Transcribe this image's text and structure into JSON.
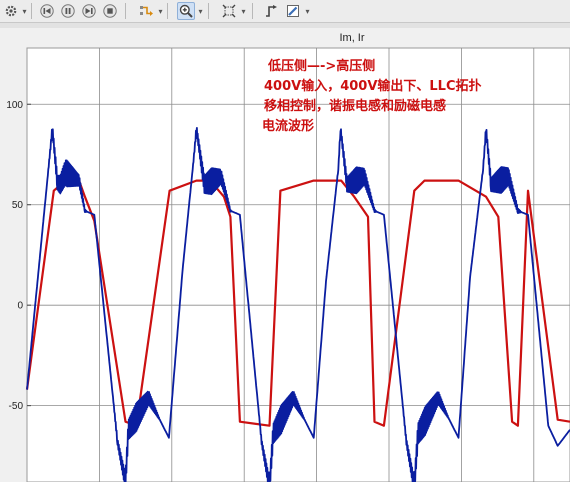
{
  "toolbar": {
    "items": [
      {
        "icon": "gear-icon",
        "dropdown": true
      },
      {
        "icon": "step-back-icon"
      },
      {
        "icon": "pause-icon"
      },
      {
        "icon": "step-forward-icon"
      },
      {
        "icon": "stop-icon"
      },
      {
        "icon": "highlight-signal-icon",
        "dropdown": true
      },
      {
        "icon": "zoom-in-icon",
        "dropdown": true,
        "active": true
      },
      {
        "icon": "fit-to-view-icon",
        "dropdown": true
      },
      {
        "icon": "triggers-icon"
      },
      {
        "icon": "style-brush-icon",
        "dropdown": true
      }
    ]
  },
  "chart_data": {
    "type": "line",
    "title": "Im, Ir",
    "ylim": [
      -88,
      128
    ],
    "xlim": [
      0,
      7.5
    ],
    "yticks": [
      "100",
      "50",
      "0",
      "-50"
    ],
    "ytick_values": [
      100,
      50,
      0,
      -50
    ],
    "xgrid_values": [
      0,
      1,
      2,
      3,
      4,
      5,
      6,
      7
    ],
    "grid": true,
    "background": "#ffffff",
    "series": [
      {
        "color": "#cc1111",
        "x": [
          0,
          0.37,
          0.53,
          0.72,
          0.8,
          0.93,
          1.36,
          1.51,
          1.97,
          2.34,
          2.53,
          2.72,
          2.81,
          2.94,
          3.35,
          3.5,
          3.96,
          4.34,
          4.52,
          4.71,
          4.8,
          4.93,
          5.35,
          5.49,
          5.96,
          6.34,
          6.51,
          6.7,
          6.78,
          6.92,
          7.33,
          7.5
        ],
        "y": [
          -42,
          57,
          62,
          62,
          54,
          42,
          -58,
          -60,
          57,
          62,
          62,
          54,
          44,
          -58,
          -60,
          57,
          62,
          62,
          54,
          44,
          -58,
          -60,
          57,
          62,
          62,
          54,
          44,
          -58,
          -60,
          57,
          -57,
          -58
        ]
      },
      {
        "color": "#0a1ea0",
        "x": [
          0,
          0.35,
          0.42,
          0.46,
          0.53,
          0.72,
          0.8,
          0.93,
          1.25,
          1.36,
          1.4,
          1.68,
          1.96,
          2.15,
          2.3,
          2.34,
          2.45,
          2.68,
          2.81,
          2.94,
          3.24,
          3.35,
          3.4,
          3.68,
          3.96,
          4.13,
          4.3,
          4.33,
          4.42,
          4.66,
          4.8,
          4.93,
          5.24,
          5.35,
          5.4,
          5.68,
          5.96,
          6.12,
          6.3,
          6.34,
          6.41,
          6.65,
          6.78,
          6.92,
          7.2,
          7.33,
          7.5
        ],
        "y": [
          -42,
          88,
          61,
          60,
          66,
          62,
          47,
          45,
          -68,
          -88,
          -62,
          -46,
          -66,
          18,
          72,
          88,
          60,
          64,
          47,
          45,
          -68,
          -90,
          -64,
          -46,
          -66,
          12,
          68,
          88,
          60,
          64,
          47,
          45,
          -68,
          -90,
          -64,
          -46,
          -66,
          14,
          68,
          88,
          60,
          64,
          47,
          45,
          -60,
          -70,
          -62
        ]
      }
    ]
  },
  "annotation": {
    "lines": [
      "低压侧—->高压侧",
      "400V输入，400V输出下、LLC拓扑",
      "移相控制，谐振电感和励磁电感",
      "电流波形"
    ]
  }
}
